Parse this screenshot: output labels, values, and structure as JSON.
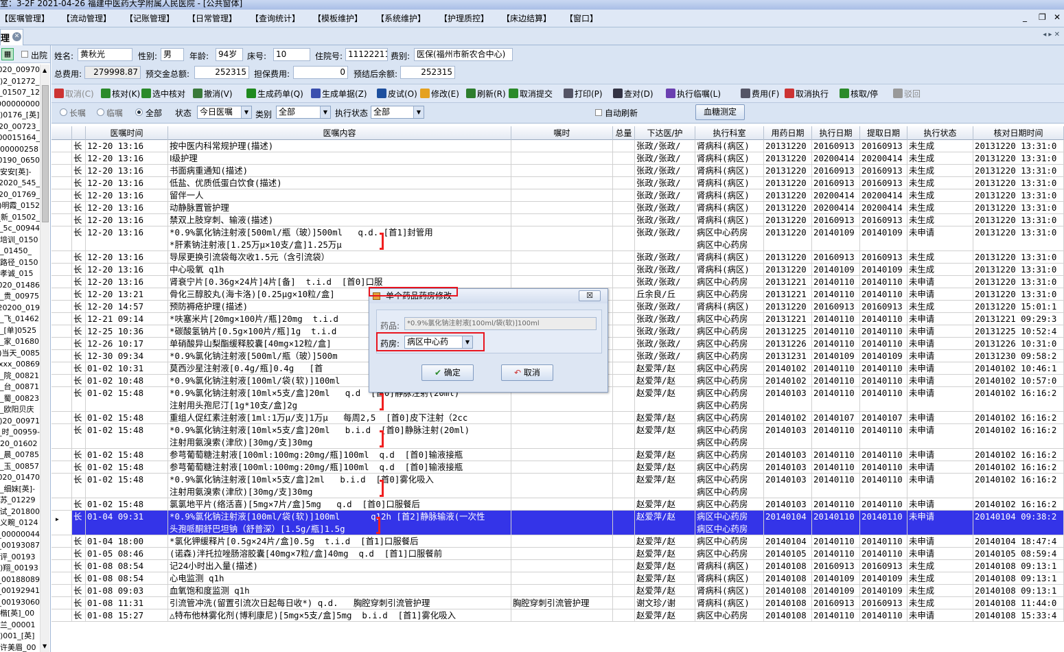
{
  "window": {
    "title": "室：3-2F  2021-04-26  福建中医药大学附属人民医院 - [公共窗体]",
    "min_icon": "_",
    "restore_icon": "❐",
    "close_icon": "✕"
  },
  "menu": [
    "【医嘱管理】",
    "【流动管理】",
    "【记账管理】",
    "【日常管理】",
    "【查询统计】",
    "【模板维护】",
    "【系统维护】",
    "【护理质控】",
    "【床边结算】",
    "【窗口】"
  ],
  "tab": {
    "label": "理",
    "close": "✕",
    "nav": "◂ ▸ ✕"
  },
  "left_panel": {
    "icon": "▦",
    "checkbox_label": "出院",
    "items": [
      "00970_2020(",
      "_01272_2(",
      "12_01507_",
      "000000000",
      "[英]_0176(",
      "_00723_20",
      "_00015164",
      "00000258",
      "0650_20190",
      "-安安[英]",
      "_545_2020(",
      "_01769_20",
      "明霞_0152(",
      "_新_01502_",
      "5c_00944_",
      "培训_0150",
      "_01450_",
      "路径_0150",
      "孝诚_015",
      "01486_2020",
      "贵_00975_",
      "019_20200(",
      "飞_01462_",
      "0525[单]_",
      "家_01680_",
      "当天_0085(",
      "xxx_00869_",
      "院_00821_",
      "台_00871_",
      "蜀_00823_",
      "欧阳贝庆_",
      "00971_20(",
      "-时_00959_",
      "01602_20",
      "晨_00785_",
      "玉_00857_",
      "01470_2020",
      "-细妹[英]_",
      "苏_01229",
      "试_201800",
      "义畹_0124",
      "00000044_",
      "00193087_",
      "评_00193",
      "翔_00193(",
      "00188089_",
      "00192941_",
      "00193060_",
      "楷[英]_00",
      "兰_00001",
      "[英]_001(",
      "许美眉_00",
      "1122211_"
    ]
  },
  "patient": {
    "name_label": "姓名:",
    "name": "黄秋光",
    "sex_label": "性别:",
    "sex": "男",
    "age_label": "年龄:",
    "age": "94岁",
    "bed_label": "床号:",
    "bed": "10",
    "admission_label": "住院号:",
    "admission_no": "11122211",
    "fee_type_label": "费别:",
    "fee_type": "医保(福州市新农合中心)",
    "total_label": "总费用:",
    "total": "279998.87",
    "prepay_label": "预交金总额:",
    "prepay": "252315",
    "guarantee_label": "担保费用:",
    "guarantee": "0",
    "balance_label": "预结后余额:",
    "balance": "252315"
  },
  "toolbar": [
    {
      "label": "取消(C)",
      "icon": "undo-icon",
      "color": "#c33",
      "enabled": false
    },
    {
      "label": "核对(K)",
      "icon": "check-icon",
      "color": "#2a8a2a",
      "enabled": true
    },
    {
      "label": "选中核对",
      "icon": "check-select-icon",
      "color": "#2a8a2a",
      "enabled": true
    },
    {
      "label": "撤消(V)",
      "icon": "revoke-icon",
      "color": "#3a7a3a",
      "enabled": true
    },
    {
      "label": "生成药单(Q)",
      "icon": "pills-icon",
      "color": "#1f8a1f",
      "enabled": true
    },
    {
      "label": "生成单据(Z)",
      "icon": "gear-icon",
      "color": "#3b4fae",
      "enabled": true
    },
    {
      "label": "皮试(O)",
      "icon": "needle-icon",
      "color": "#1d4f9e",
      "enabled": true
    },
    {
      "label": "修改(E)",
      "icon": "eraser-icon",
      "color": "#e5a11f",
      "enabled": true
    },
    {
      "label": "刷新(R)",
      "icon": "refresh-icon",
      "color": "#2d7d2d",
      "enabled": true
    },
    {
      "label": "取消提交",
      "icon": "cancel-submit-icon",
      "color": "#2a8a2a",
      "enabled": true
    },
    {
      "label": "打印(P)",
      "icon": "printer-icon",
      "color": "#556",
      "enabled": true
    },
    {
      "label": "查对(D)",
      "icon": "magnifier-icon",
      "color": "#334",
      "enabled": true
    },
    {
      "label": "执行临嘱(L)",
      "icon": "execute-icon",
      "color": "#6a3fb0",
      "enabled": true
    },
    {
      "label": "费用(F)",
      "icon": "fee-icon",
      "color": "#556",
      "enabled": true
    },
    {
      "label": "取消执行",
      "icon": "undo-exec-icon",
      "color": "#c33",
      "enabled": true
    },
    {
      "label": "核取/停",
      "icon": "check-stop-icon",
      "color": "#2a8a2a",
      "enabled": true
    },
    {
      "label": "驳回",
      "icon": "reject-icon",
      "color": "#999",
      "enabled": false
    }
  ],
  "filters": {
    "radio_long": "长嘱",
    "radio_temp": "临嘱",
    "radio_all": "全部",
    "selected": "全部",
    "status_label": "状态",
    "status_value": "今日医嘱",
    "category_label": "类别",
    "category_value": "全部",
    "exec_status_label": "执行状态",
    "exec_status_value": "全部",
    "auto_refresh_label": "自动刷新",
    "blood_sugar_button": "血糖测定"
  },
  "grid": {
    "columns": [
      "",
      "",
      "医嘱时间",
      "医嘱内容",
      "嘱时",
      "总量",
      "下达医/护",
      "执行科室",
      "用药日期",
      "执行日期",
      "提取日期",
      "执行状态",
      "核对日期时间"
    ],
    "rows": [
      {
        "type": "长",
        "time": "12-20 13:16",
        "content": [
          "按中医内科常规护理(描述)"
        ],
        "note": "",
        "doctor": [
          "张政/张政/"
        ],
        "dept": [
          "肾病科(病区)"
        ],
        "use": "20131220",
        "exec": "20160913",
        "fetch": "20160913",
        "status": "未生成",
        "check": "20131220 13:31:0"
      },
      {
        "type": "长",
        "time": "12-20 13:16",
        "content": [
          "Ⅰ级护理"
        ],
        "note": "",
        "doctor": [
          "张政/张政/"
        ],
        "dept": [
          "肾病科(病区)"
        ],
        "use": "20131220",
        "exec": "20200414",
        "fetch": "20200414",
        "status": "未生成",
        "check": "20131220 13:31:0"
      },
      {
        "type": "长",
        "time": "12-20 13:16",
        "content": [
          "书面病重通知(描述)"
        ],
        "note": "",
        "doctor": [
          "张政/张政/"
        ],
        "dept": [
          "肾病科(病区)"
        ],
        "use": "20131220",
        "exec": "20160913",
        "fetch": "20160913",
        "status": "未生成",
        "check": "20131220 13:31:0"
      },
      {
        "type": "长",
        "time": "12-20 13:16",
        "content": [
          "低盐、优质低蛋白饮食(描述)"
        ],
        "note": "",
        "doctor": [
          "张政/张政/"
        ],
        "dept": [
          "肾病科(病区)"
        ],
        "use": "20131220",
        "exec": "20160913",
        "fetch": "20160913",
        "status": "未生成",
        "check": "20131220 13:31:0"
      },
      {
        "type": "长",
        "time": "12-20 13:16",
        "content": [
          "留伴一人"
        ],
        "note": "",
        "doctor": [
          "张政/张政/"
        ],
        "dept": [
          "肾病科(病区)"
        ],
        "use": "20131220",
        "exec": "20200414",
        "fetch": "20200414",
        "status": "未生成",
        "check": "20131220 13:31:0"
      },
      {
        "type": "长",
        "time": "12-20 13:16",
        "content": [
          "动静脉置管护理"
        ],
        "note": "",
        "doctor": [
          "张政/张政/"
        ],
        "dept": [
          "肾病科(病区)"
        ],
        "use": "20131220",
        "exec": "20200414",
        "fetch": "20200414",
        "status": "未生成",
        "check": "20131220 13:31:0"
      },
      {
        "type": "长",
        "time": "12-20 13:16",
        "content": [
          "禁双上肢穿刺、输液(描述)"
        ],
        "note": "",
        "doctor": [
          "张政/张政/"
        ],
        "dept": [
          "肾病科(病区)"
        ],
        "use": "20131220",
        "exec": "20160913",
        "fetch": "20160913",
        "status": "未生成",
        "check": "20131220 13:31:0"
      },
      {
        "type": "长",
        "time": "12-20 13:16",
        "content": [
          "*0.9%氯化钠注射液[500ml/瓶（玻）]500ml   q.d. [首1]封管用",
          "*肝素钠注射液[1.25万μ×10支/盒]1.25万μ"
        ],
        "note": "",
        "doctor": [
          "张政/张政/"
        ],
        "dept": [
          "病区中心药房",
          "病区中心药房"
        ],
        "use": "20131220",
        "exec": "20140109",
        "fetch": "20140109",
        "status": "未申请",
        "check": "20131220 13:31:0",
        "bracket": true
      },
      {
        "type": "长",
        "time": "12-20 13:16",
        "content": [
          "导尿更换引流袋每次收1.5元（含引流袋）"
        ],
        "note": "",
        "doctor": [
          "张政/张政/"
        ],
        "dept": [
          "肾病科(病区)"
        ],
        "use": "20131220",
        "exec": "20160913",
        "fetch": "20160913",
        "status": "未生成",
        "check": "20131220 13:31:0"
      },
      {
        "type": "长",
        "time": "12-20 13:16",
        "content": [
          "中心吸氧 q1h"
        ],
        "note": "",
        "doctor": [
          "张政/张政/"
        ],
        "dept": [
          "肾病科(病区)"
        ],
        "use": "20131220",
        "exec": "20140109",
        "fetch": "20140109",
        "status": "未生成",
        "check": "20131220 13:31:0"
      },
      {
        "type": "长",
        "time": "12-20 13:16",
        "content": [
          "肾衰宁片[0.36g×24片]4片[备]  t.i.d  [首0]口服"
        ],
        "note": "",
        "doctor": [
          "张政/张政/"
        ],
        "dept": [
          "病区中心药房"
        ],
        "use": "20131221",
        "exec": "20140110",
        "fetch": "20140110",
        "status": "未申请",
        "check": "20131220 13:31:0"
      },
      {
        "type": "长",
        "time": "12-20 13:21",
        "content": [
          "骨化三醇胶丸(海卡洛)[0.25μg×10粒/盒]"
        ],
        "note": "",
        "doctor": [
          "丘余良/丘"
        ],
        "dept": [
          "病区中心药房"
        ],
        "use": "20131221",
        "exec": "20140110",
        "fetch": "20140110",
        "status": "未申请",
        "check": "20131220 13:31:0"
      },
      {
        "type": "长",
        "time": "12-20 14:57",
        "content": [
          "预防褥疮护理(描述)"
        ],
        "note": "",
        "doctor": [
          "张政/张政/"
        ],
        "dept": [
          "肾病科(病区)"
        ],
        "use": "20131220",
        "exec": "20160913",
        "fetch": "20160913",
        "status": "未生成",
        "check": "20131220 15:01:1"
      },
      {
        "type": "长",
        "time": "12-21 09:14",
        "content": [
          "*呋塞米片[20mg×100片/瓶]20mg  t.i.d"
        ],
        "note": "",
        "doctor": [
          "张政/张政/"
        ],
        "dept": [
          "病区中心药房"
        ],
        "use": "20131221",
        "exec": "20140110",
        "fetch": "20140110",
        "status": "未申请",
        "check": "20131221 09:29:3"
      },
      {
        "type": "长",
        "time": "12-25 10:36",
        "content": [
          "*碳酸氢钠片[0.5g×100片/瓶]1g  t.i.d"
        ],
        "note": "",
        "doctor": [
          "张政/张政/"
        ],
        "dept": [
          "病区中心药房"
        ],
        "use": "20131225",
        "exec": "20140110",
        "fetch": "20140110",
        "status": "未申请",
        "check": "20131225 10:52:4"
      },
      {
        "type": "长",
        "time": "12-26 10:17",
        "content": [
          "单硝酸异山梨酯缓释胶囊[40mg×12粒/盒]"
        ],
        "note": "",
        "doctor": [
          "张政/张政/"
        ],
        "dept": [
          "病区中心药房"
        ],
        "use": "20131226",
        "exec": "20140110",
        "fetch": "20140110",
        "status": "未申请",
        "check": "20131226 10:31:0"
      },
      {
        "type": "长",
        "time": "12-30 09:34",
        "content": [
          "*0.9%氯化钠注射液[500ml/瓶（玻）]500m"
        ],
        "note": "",
        "doctor": [
          "张政/张政/"
        ],
        "dept": [
          "病区中心药房"
        ],
        "use": "20131231",
        "exec": "20140109",
        "fetch": "20140109",
        "status": "未申请",
        "check": "20131230 09:58:2"
      },
      {
        "type": "长",
        "time": "01-02 10:31",
        "content": [
          "莫西沙星注射液[0.4g/瓶]0.4g   [首"
        ],
        "note": "",
        "doctor": [
          "赵爱萍/赵"
        ],
        "dept": [
          "病区中心药房"
        ],
        "use": "20140102",
        "exec": "20140110",
        "fetch": "20140110",
        "status": "未申请",
        "check": "20140102 10:46:1"
      },
      {
        "type": "长",
        "time": "01-02 10:48",
        "content": [
          "*0.9%氯化钠注射液[100ml/袋(软)]100ml"
        ],
        "note": "",
        "doctor": [
          "赵爱萍/赵"
        ],
        "dept": [
          "病区中心药房"
        ],
        "use": "20140102",
        "exec": "20140110",
        "fetch": "20140110",
        "status": "未申请",
        "check": "20140102 10:57:0"
      },
      {
        "type": "长",
        "time": "01-02 15:48",
        "content": [
          "*0.9%氯化钠注射液[10ml×5支/盒]20ml   q.d  [首0]静脉注射(20ml)",
          "注射用头孢尼汀[1g*10支/盒]2g"
        ],
        "note": "",
        "doctor": [
          "赵爱萍/赵"
        ],
        "dept": [
          "病区中心药房",
          "病区中心药房"
        ],
        "use": "20140103",
        "exec": "20140110",
        "fetch": "20140110",
        "status": "未申请",
        "check": "20140102 16:16:2",
        "bracket": true
      },
      {
        "type": "长",
        "time": "01-02 15:48",
        "content": [
          "重组人促红素注射液[1ml:1万μ/支]1万μ   每周2,5  [首0]皮下注射（2cc"
        ],
        "note": "",
        "doctor": [
          "赵爱萍/赵"
        ],
        "dept": [
          "病区中心药房"
        ],
        "use": "20140102",
        "exec": "20140107",
        "fetch": "20140107",
        "status": "未申请",
        "check": "20140102 16:16:2"
      },
      {
        "type": "长",
        "time": "01-02 15:48",
        "content": [
          "*0.9%氯化钠注射液[10ml×5支/盒]20ml   b.i.d  [首0]静脉注射(20ml)",
          "注射用氨溴索(津欣)[30mg/支]30mg"
        ],
        "note": "",
        "doctor": [
          "赵爱萍/赵"
        ],
        "dept": [
          "病区中心药房",
          "病区中心药房"
        ],
        "use": "20140103",
        "exec": "20140110",
        "fetch": "20140110",
        "status": "未申请",
        "check": "20140102 16:16:2",
        "bracket": true
      },
      {
        "type": "长",
        "time": "01-02 15:48",
        "content": [
          "参芎葡萄糖注射液[100ml:100mg:20mg/瓶]100ml  q.d  [首0]输液接瓶"
        ],
        "note": "",
        "doctor": [
          "赵爱萍/赵"
        ],
        "dept": [
          "病区中心药房"
        ],
        "use": "20140103",
        "exec": "20140110",
        "fetch": "20140110",
        "status": "未申请",
        "check": "20140102 16:16:2"
      },
      {
        "type": "长",
        "time": "01-02 15:48",
        "content": [
          "参芎葡萄糖注射液[100ml:100mg:20mg/瓶]100ml  q.d  [首0]输液接瓶"
        ],
        "note": "",
        "doctor": [
          "赵爱萍/赵"
        ],
        "dept": [
          "病区中心药房"
        ],
        "use": "20140103",
        "exec": "20140110",
        "fetch": "20140110",
        "status": "未申请",
        "check": "20140102 16:16:2"
      },
      {
        "type": "长",
        "time": "01-02 15:48",
        "content": [
          "*0.9%氯化钠注射液[10ml×5支/盒]2ml   b.i.d  [首0]雾化吸入",
          "注射用氨溴索(津欣)[30mg/支]30mg"
        ],
        "note": "",
        "doctor": [
          "赵爱萍/赵"
        ],
        "dept": [
          "病区中心药房",
          "病区中心药房"
        ],
        "use": "20140103",
        "exec": "20140110",
        "fetch": "20140110",
        "status": "未申请",
        "check": "20140102 16:16:2",
        "bracket": true
      },
      {
        "type": "长",
        "time": "01-02 15:48",
        "content": [
          "氯氯地平片(络活喜)[5mg×7片/盒]5mg   q.d  [首0]口服餐后"
        ],
        "note": "",
        "doctor": [
          "赵爱萍/赵"
        ],
        "dept": [
          "病区中心药房"
        ],
        "use": "20140103",
        "exec": "20140110",
        "fetch": "20140110",
        "status": "未申请",
        "check": "20140102 16:16:2"
      },
      {
        "type": "长",
        "time": "01-04 09:31",
        "content": [
          "*0.9%氯化钠注射液[100ml/袋(软)]100ml      q12h [首2]静脉输液(一次性",
          "头孢哌酮舒巴坦钠（舒普深）[1.5g/瓶]1.5g"
        ],
        "note": "",
        "doctor": [
          "赵爱萍/赵"
        ],
        "dept": [
          "病区中心药房",
          "病区中心药房"
        ],
        "use": "20140104",
        "exec": "20140110",
        "fetch": "20140110",
        "status": "未申请",
        "check": "20140104 09:38:2",
        "bracket": true,
        "selected": true
      },
      {
        "type": "长",
        "time": "01-04 18:00",
        "content": [
          "*氯化钾缓释片[0.5g×24片/盒]0.5g  t.i.d  [首1]口服餐后"
        ],
        "note": "",
        "doctor": [
          "赵爱萍/赵"
        ],
        "dept": [
          "病区中心药房"
        ],
        "use": "20140104",
        "exec": "20140110",
        "fetch": "20140110",
        "status": "未申请",
        "check": "20140104 18:47:4"
      },
      {
        "type": "长",
        "time": "01-05 08:46",
        "content": [
          "(诺森)泮托拉唑肠溶胶囊[40mg×7粒/盒]40mg  q.d  [首1]口服餐前"
        ],
        "note": "",
        "doctor": [
          "赵爱萍/赵"
        ],
        "dept": [
          "病区中心药房"
        ],
        "use": "20140105",
        "exec": "20140110",
        "fetch": "20140110",
        "status": "未申请",
        "check": "20140105 08:59:4"
      },
      {
        "type": "长",
        "time": "01-08 08:54",
        "content": [
          "记24小时出入量(描述)"
        ],
        "note": "",
        "doctor": [
          "赵爱萍/赵"
        ],
        "dept": [
          "肾病科(病区)"
        ],
        "use": "20140108",
        "exec": "20160913",
        "fetch": "20160913",
        "status": "未生成",
        "check": "20140108 09:13:1"
      },
      {
        "type": "长",
        "time": "01-08 08:54",
        "content": [
          "心电监测 q1h"
        ],
        "note": "",
        "doctor": [
          "赵爱萍/赵"
        ],
        "dept": [
          "肾病科(病区)"
        ],
        "use": "20140108",
        "exec": "20140109",
        "fetch": "20140109",
        "status": "未生成",
        "check": "20140108 09:13:1"
      },
      {
        "type": "长",
        "time": "01-08 09:03",
        "content": [
          "血氧饱和度监测 q1h"
        ],
        "note": "",
        "doctor": [
          "赵爱萍/赵"
        ],
        "dept": [
          "肾病科(病区)"
        ],
        "use": "20140108",
        "exec": "20140109",
        "fetch": "20140109",
        "status": "未生成",
        "check": "20140108 09:13:1"
      },
      {
        "type": "长",
        "time": "01-08 11:31",
        "content": [
          "引流管冲洗(留置引流次日起每日收*) q.d.   胸腔穿刺引流管护理"
        ],
        "note": "胸腔穿刺引流管护理",
        "doctor": [
          "谢文珍/谢"
        ],
        "dept": [
          "肾病科(病区)"
        ],
        "use": "20140108",
        "exec": "20160913",
        "fetch": "20160913",
        "status": "未生成",
        "check": "20140108 11:44:0"
      },
      {
        "type": "长",
        "time": "01-08 15:27",
        "content": [
          "△特布他林雾化剂(博利康尼)[5mg×5支/盒]5mg  b.i.d  [首1]雾化吸入"
        ],
        "note": "",
        "doctor": [
          "赵爱萍/赵"
        ],
        "dept": [
          "病区中心药房"
        ],
        "use": "20140108",
        "exec": "20140110",
        "fetch": "20140110",
        "status": "未申请",
        "check": "20140108 15:33:4"
      }
    ]
  },
  "dialog": {
    "title": "单个药品药房修改",
    "close_label": "☒",
    "drug_label": "药品:",
    "drug_value": "*0.9%氯化钠注射液[100ml/袋(软)]100ml",
    "pharmacy_label": "药房:",
    "pharmacy_value": "病区中心药",
    "ok_label": "确定",
    "cancel_label": "取消"
  }
}
